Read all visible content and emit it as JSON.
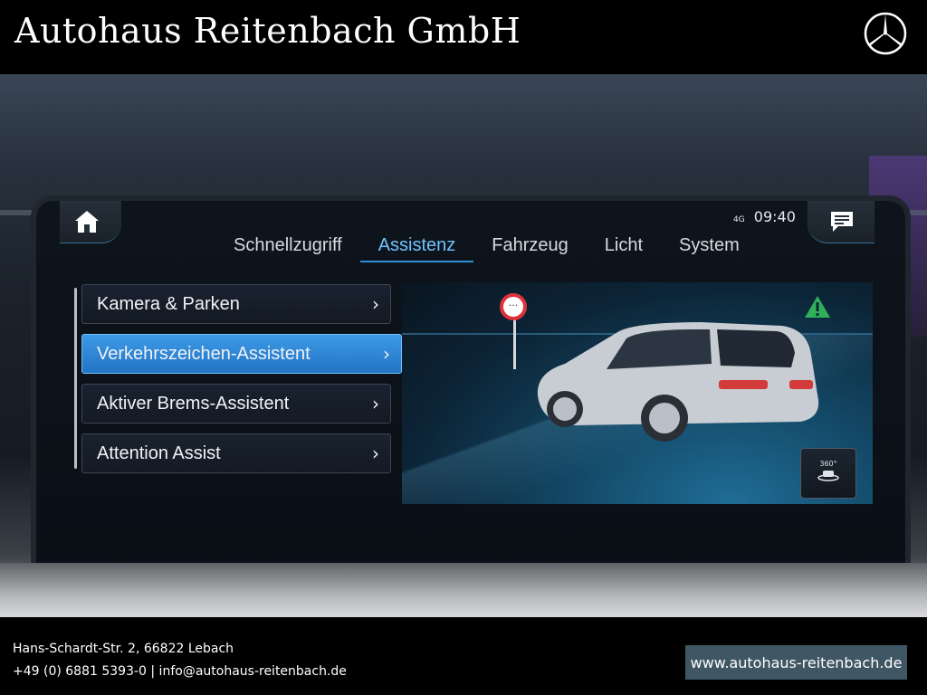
{
  "banner": {
    "title": "Autohaus Reitenbach GmbH",
    "logo_icon": "mercedes-star-logo"
  },
  "screen": {
    "status": {
      "network": "4G",
      "time": "09:40"
    },
    "tabs": [
      {
        "label": "Schnellzugriff",
        "active": false
      },
      {
        "label": "Assistenz",
        "active": true
      },
      {
        "label": "Fahrzeug",
        "active": false
      },
      {
        "label": "Licht",
        "active": false
      },
      {
        "label": "System",
        "active": false
      }
    ],
    "menu": [
      {
        "label": "Kamera & Parken",
        "selected": false
      },
      {
        "label": "Verkehrszeichen-Assistent",
        "selected": true
      },
      {
        "label": "Aktiver Brems-Assistent",
        "selected": false
      },
      {
        "label": "Attention Assist",
        "selected": false
      }
    ],
    "chevron": "›",
    "view360_label": "360°",
    "icons": {
      "home": "home-icon",
      "messages": "message-icon",
      "warning": "warning-triangle-icon",
      "sign": "traffic-sign-icon",
      "car": "car-icon",
      "view360": "camera-360-icon"
    },
    "colors": {
      "accent": "#2f8fd8",
      "selected": "#2f86d6",
      "warning": "#2fb05a",
      "sign_ring": "#e0313b"
    }
  },
  "footer": {
    "address": "Hans-Schardt-Str. 2, 66822 Lebach",
    "contact": "+49 (0) 6881 5393-0  |  info@autohaus-reitenbach.de",
    "website": "www.autohaus-reitenbach.de"
  }
}
